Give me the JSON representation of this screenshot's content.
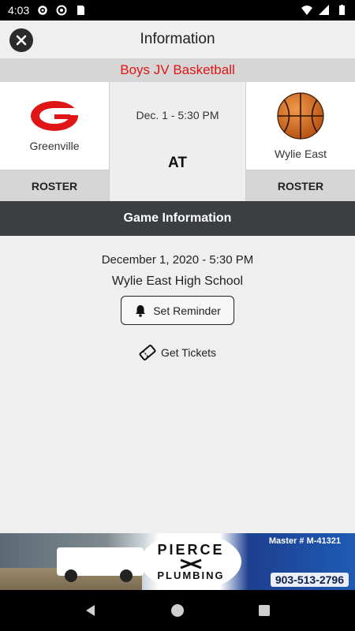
{
  "status_bar": {
    "time": "4:03"
  },
  "header": {
    "title": "Information"
  },
  "sport": "Boys JV Basketball",
  "home_team": {
    "name": "Greenville",
    "logo_letter": "G",
    "roster_label": "ROSTER"
  },
  "away_team": {
    "name": "Wylie East",
    "roster_label": "ROSTER"
  },
  "matchup": {
    "short_date": "Dec. 1 - 5:30 PM",
    "separator": "AT"
  },
  "game_info": {
    "heading": "Game Information",
    "datetime": "December 1, 2020 - 5:30 PM",
    "venue": "Wylie East High School",
    "reminder_label": "Set Reminder",
    "tickets_label": "Get Tickets"
  },
  "ad": {
    "brand_line1": "PIERCE",
    "brand_line2": "PLUMBING",
    "license": "Master # M-41321",
    "phone": "903-513-2796"
  },
  "colors": {
    "accent": "#e01515",
    "dark_bar": "#3b3f42",
    "ball": "#d2691e"
  }
}
